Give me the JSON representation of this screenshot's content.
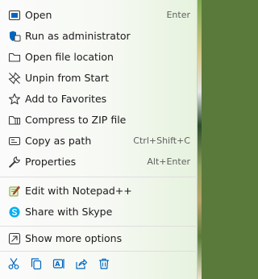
{
  "menu": {
    "items": [
      {
        "label": "Open",
        "shortcut": "Enter",
        "icon": "app-window-icon"
      },
      {
        "label": "Run as administrator",
        "shortcut": "",
        "icon": "shield-icon"
      },
      {
        "label": "Open file location",
        "shortcut": "",
        "icon": "folder-icon"
      },
      {
        "label": "Unpin from Start",
        "shortcut": "",
        "icon": "unpin-icon"
      },
      {
        "label": "Add to Favorites",
        "shortcut": "",
        "icon": "star-icon"
      },
      {
        "label": "Compress to ZIP file",
        "shortcut": "",
        "icon": "zip-folder-icon"
      },
      {
        "label": "Copy as path",
        "shortcut": "Ctrl+Shift+C",
        "icon": "copy-path-icon"
      },
      {
        "label": "Properties",
        "shortcut": "Alt+Enter",
        "icon": "wrench-icon"
      },
      {
        "label": "Edit with Notepad++",
        "shortcut": "",
        "icon": "notepad-plus-icon"
      },
      {
        "label": "Share with Skype",
        "shortcut": "",
        "icon": "skype-icon"
      },
      {
        "label": "Show more options",
        "shortcut": "",
        "icon": "show-more-icon"
      }
    ],
    "bottom_icons": [
      "cut-icon",
      "copy-icon",
      "rename-icon",
      "share-icon",
      "delete-icon"
    ],
    "accent_color": "#0067c0",
    "skype_color": "#00aff0"
  }
}
